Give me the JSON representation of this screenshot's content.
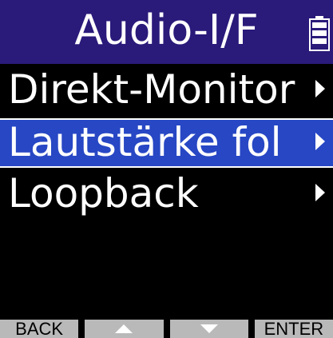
{
  "header": {
    "title": "Audio-I/F",
    "battery_icon": "battery-icon"
  },
  "menu": {
    "items": [
      {
        "label": "Direkt-Monitor",
        "icon": "chevron-right-icon",
        "selected": false
      },
      {
        "label": "Lautstärke fol",
        "icon": "chevron-right-icon",
        "selected": true
      },
      {
        "label": "Loopback",
        "icon": "chevron-right-icon",
        "selected": false
      }
    ]
  },
  "function_bar": {
    "back_label": "BACK",
    "up_icon": "up-arrow-icon",
    "down_icon": "down-arrow-icon",
    "enter_label": "ENTER"
  },
  "colors": {
    "title_background": "#2a1a7a",
    "selected_background": "#2747c4",
    "function_button": "#b9b9b9",
    "background": "#000000",
    "text": "#ffffff"
  }
}
